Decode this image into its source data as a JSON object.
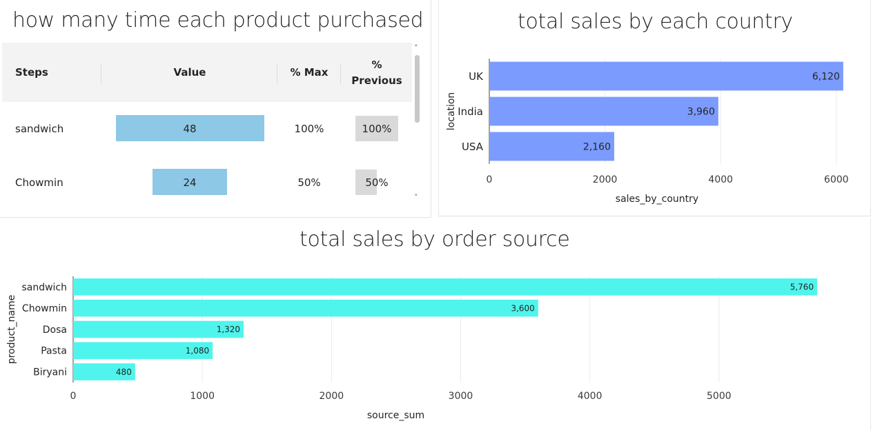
{
  "funnel": {
    "title": "how many time each product purchased",
    "headers": {
      "steps": "Steps",
      "value": "Value",
      "pct_max": "% Max",
      "pct_prev_line1": "%",
      "pct_prev_line2": "Previous"
    },
    "rows": [
      {
        "step": "sandwich",
        "value": "48",
        "pct_max": "100%",
        "pct_prev": "100%",
        "value_fraction": 1.0,
        "prev_fraction": 1.0
      },
      {
        "step": "Chowmin",
        "value": "24",
        "pct_max": "50%",
        "pct_prev": "50%",
        "value_fraction": 0.5,
        "prev_fraction": 0.5
      }
    ],
    "scroll_up": "˄",
    "scroll_down": "˅"
  },
  "country": {
    "title": "total sales by each country",
    "color": "#7b9bff"
  },
  "source": {
    "title": "total sales by order source",
    "color": "#4ff5ec"
  },
  "chart_data": [
    {
      "type": "bar",
      "orientation": "horizontal",
      "title": "total sales by each country",
      "xlabel": "sales_by_country",
      "ylabel": "location",
      "categories": [
        "UK",
        "India",
        "USA"
      ],
      "values": [
        6120,
        3960,
        2160
      ],
      "data_labels": [
        "6,120",
        "3,960",
        "2,160"
      ],
      "xlim": [
        0,
        6300
      ],
      "xticks": [
        0,
        2000,
        4000,
        6000
      ],
      "xtick_labels": [
        "0",
        "2000",
        "4000",
        "6000"
      ],
      "grid": true
    },
    {
      "type": "bar",
      "orientation": "horizontal",
      "title": "total sales by order source",
      "xlabel": "source_sum",
      "ylabel": "product_name",
      "categories": [
        "sandwich",
        "Chowmin",
        "Dosa",
        "Pasta",
        "Biryani"
      ],
      "values": [
        5760,
        3600,
        1320,
        1080,
        480
      ],
      "data_labels": [
        "5,760",
        "3,600",
        "1,320",
        "1,080",
        "480"
      ],
      "xlim": [
        0,
        6000
      ],
      "xticks": [
        0,
        1000,
        2000,
        3000,
        4000,
        5000
      ],
      "xtick_labels": [
        "0",
        "1000",
        "2000",
        "3000",
        "4000",
        "5000"
      ],
      "grid": true
    }
  ]
}
